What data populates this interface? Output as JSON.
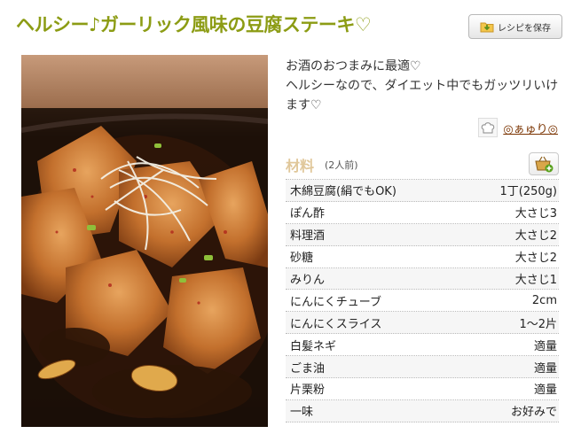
{
  "recipe": {
    "title": "ヘルシー♪ガーリック風味の豆腐ステーキ♡",
    "save_label": "レシピを保存",
    "description": "お酒のおつまみに最適♡\nヘルシーなので、ダイエット中でもガッツリいけます♡",
    "author": "◎ぁゅり◎"
  },
  "ingredients": {
    "title": "材料",
    "serving": "(2人前)",
    "items": [
      {
        "name": "木綿豆腐(絹でもOK)",
        "amount": "1丁(250g)"
      },
      {
        "name": "ぽん酢",
        "amount": "大さじ3"
      },
      {
        "name": "料理酒",
        "amount": "大さじ2"
      },
      {
        "name": "砂糖",
        "amount": "大さじ2"
      },
      {
        "name": "みりん",
        "amount": "大さじ1"
      },
      {
        "name": "にんにくチューブ",
        "amount": "2cm"
      },
      {
        "name": "にんにくスライス",
        "amount": "1〜2片"
      },
      {
        "name": "白髪ネギ",
        "amount": "適量"
      },
      {
        "name": "ごま油",
        "amount": "適量"
      },
      {
        "name": "片栗粉",
        "amount": "適量"
      },
      {
        "name": "一味",
        "amount": "お好みで"
      }
    ]
  },
  "colors": {
    "title_green": "#8c9c14",
    "author_brown": "#7a3300",
    "ingredient_heading": "#e0c79a"
  },
  "icons": {
    "save": "folder-save-icon",
    "author": "chef-hat-icon",
    "shopping": "shopping-basket-add-icon"
  }
}
